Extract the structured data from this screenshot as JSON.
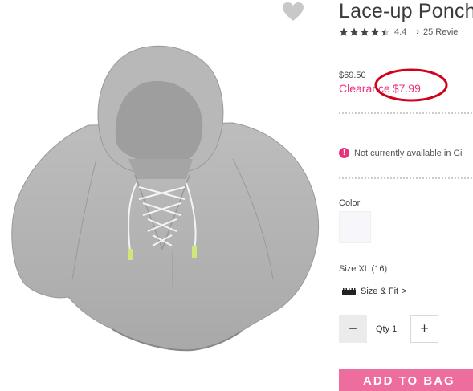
{
  "product": {
    "title": "Lace-up Ponch",
    "rating": {
      "value": "4.4",
      "stars_filled": 4.4,
      "stars_total": 5,
      "reviews_text": "25 Revie"
    },
    "old_price": "$69.50",
    "sale_label": "Clearance",
    "sale_price": "$7.99",
    "availability": "Not currently available in Gi",
    "color_label": "Color",
    "size_label": "Size XL (16)",
    "size_fit_label": "Size & Fit",
    "size_fit_chevron": ">",
    "qty_label": "Qty 1",
    "qty_minus": "−",
    "qty_plus": "+",
    "add_to_bag": "ADD TO BAG",
    "alert_glyph": "!",
    "reviews_chevron": "›"
  },
  "icons": {
    "favorite": "heart-icon",
    "alert": "alert-icon",
    "size_fit": "ruler-icon"
  },
  "colors": {
    "accent_pink": "#e8327c",
    "button_pink": "#ee6d9f",
    "annotation_red": "#d0021b",
    "swatch": "#f7f7fb"
  }
}
